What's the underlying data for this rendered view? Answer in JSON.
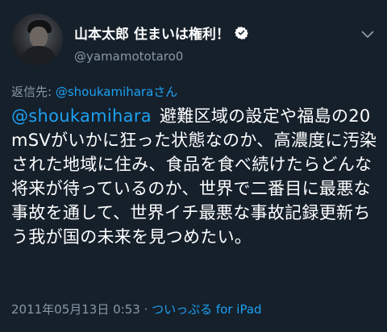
{
  "author": {
    "display_name": "山本太郎 住まいは権利！",
    "handle": "@yamamototaro0",
    "verified_icon": "verified-badge-icon"
  },
  "reply": {
    "prefix": "返信先: ",
    "mention": "@shoukamiharaさん"
  },
  "tweet": {
    "mention": "@shoukamihara",
    "text": "避難区域の設定や福島の20mSVがいかに狂った状態なのか、高濃度に汚染された地域に住み、食品を食べ続けたらどんな将来が待っているのか、世界で二番目に最悪な事故を通して、世界イチ最悪な事故記録更新ちう我が国の未来を見つめたい。"
  },
  "meta": {
    "timestamp": "2011年05月13日 0:53",
    "separator": " · ",
    "source": "ついっぷる for iPad"
  },
  "colors": {
    "background": "#15202b",
    "text": "#ffffff",
    "secondary": "#8899a6",
    "accent": "#1da1f2"
  }
}
